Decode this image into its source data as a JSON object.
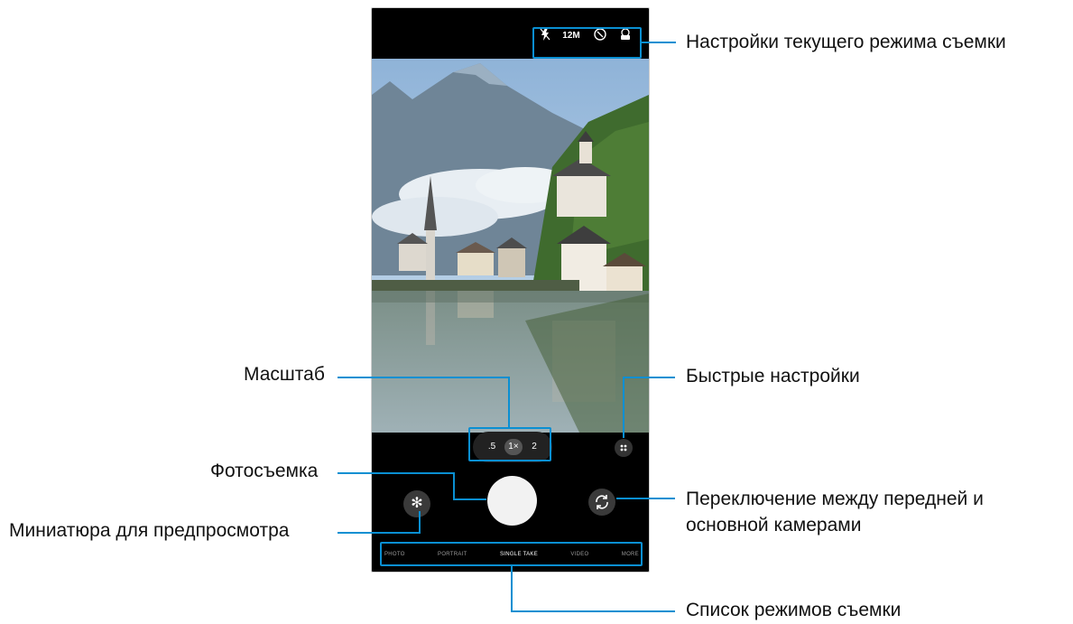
{
  "camera": {
    "status_icons": [
      "flash-off-icon",
      "motion-icon",
      "timer-icon",
      "filter-icon"
    ],
    "resolution": "12M",
    "zoom_levels": [
      ".5",
      "1×",
      "2"
    ],
    "active_zoom": "1×",
    "modes": [
      "PHOTO",
      "PORTRAIT",
      "SINGLE TAKE",
      "VIDEO",
      "MORE"
    ],
    "active_mode": "SINGLE TAKE"
  },
  "callouts": {
    "current_mode_settings": "Настройки текущего режима съемки",
    "zoom": "Масштаб",
    "quick_settings": "Быстрые настройки",
    "capture": "Фотосъемка",
    "switch_camera_line1": "Переключение между передней и",
    "switch_camera_line2": "основной камерами",
    "preview_thumbnail": "Миниатюра для предпросмотра",
    "modes_list": "Список режимов съемки"
  },
  "colors": {
    "accent": "#0a8fd2",
    "background": "#000000"
  }
}
